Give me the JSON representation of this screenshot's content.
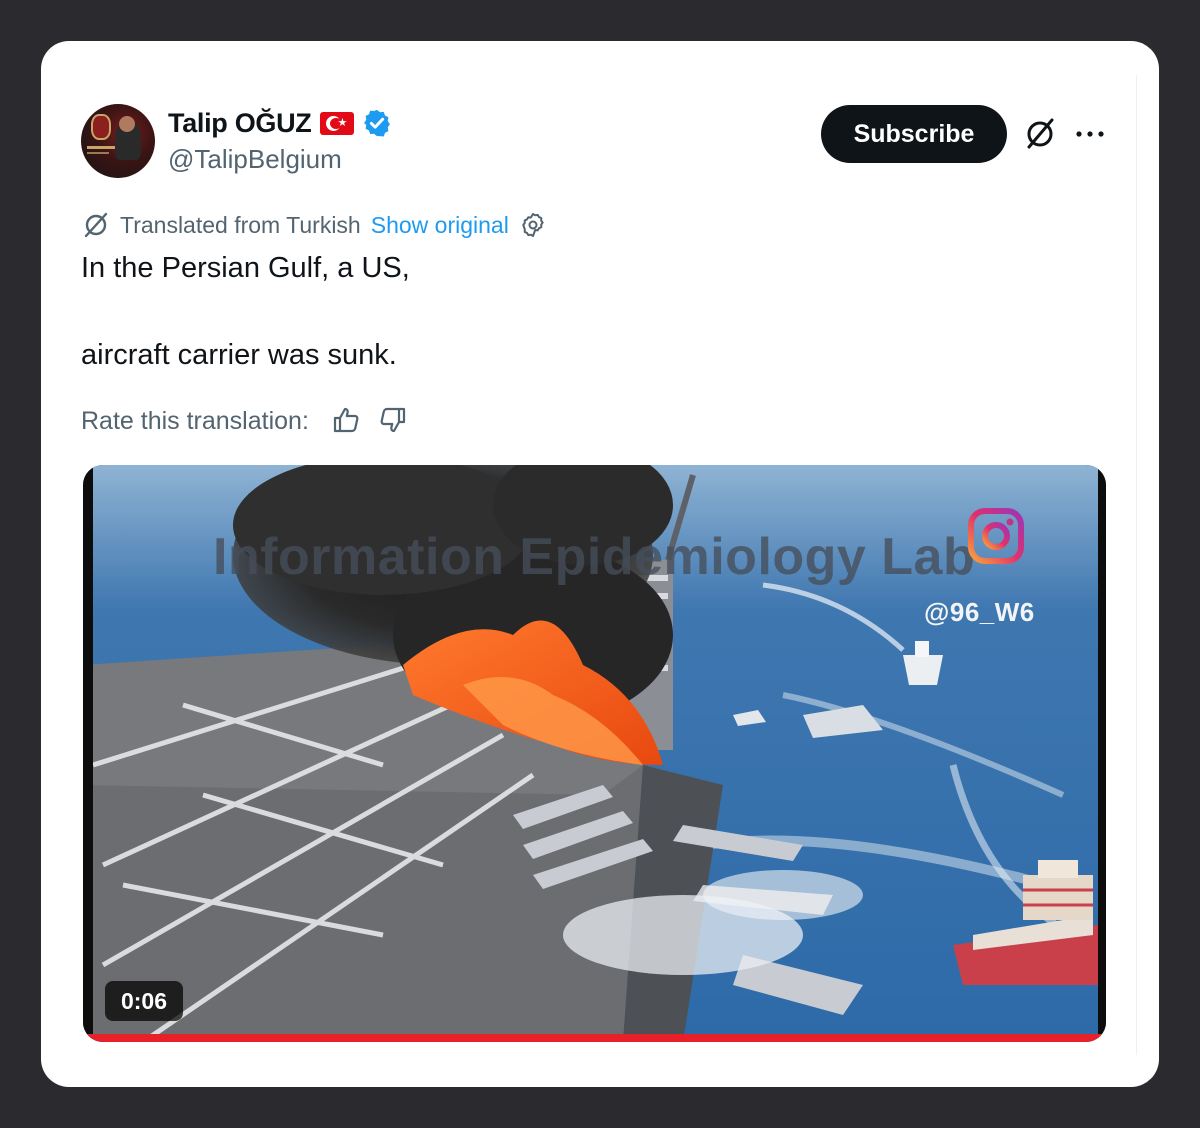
{
  "author": {
    "display_name": "Talip OĞUZ",
    "handle": "@TalipBelgium",
    "flag": "turkey-flag-icon",
    "verified": true
  },
  "actions": {
    "subscribe_label": "Subscribe",
    "grok_icon": "grok-icon",
    "more_icon": "more-icon"
  },
  "translation": {
    "notice": "Translated from Turkish",
    "show_original": "Show original",
    "settings_icon": "gear-icon",
    "rate_label": "Rate this translation:"
  },
  "tweet": {
    "line1": "In the Persian Gulf, a US,",
    "line2": "aircraft carrier was sunk."
  },
  "media": {
    "watermark": "Information Epidemiology Lab",
    "overlay_handle": "@96_W6",
    "duration": "0:06"
  },
  "colors": {
    "accent": "#1d9bf0",
    "progress": "#e8202a"
  }
}
